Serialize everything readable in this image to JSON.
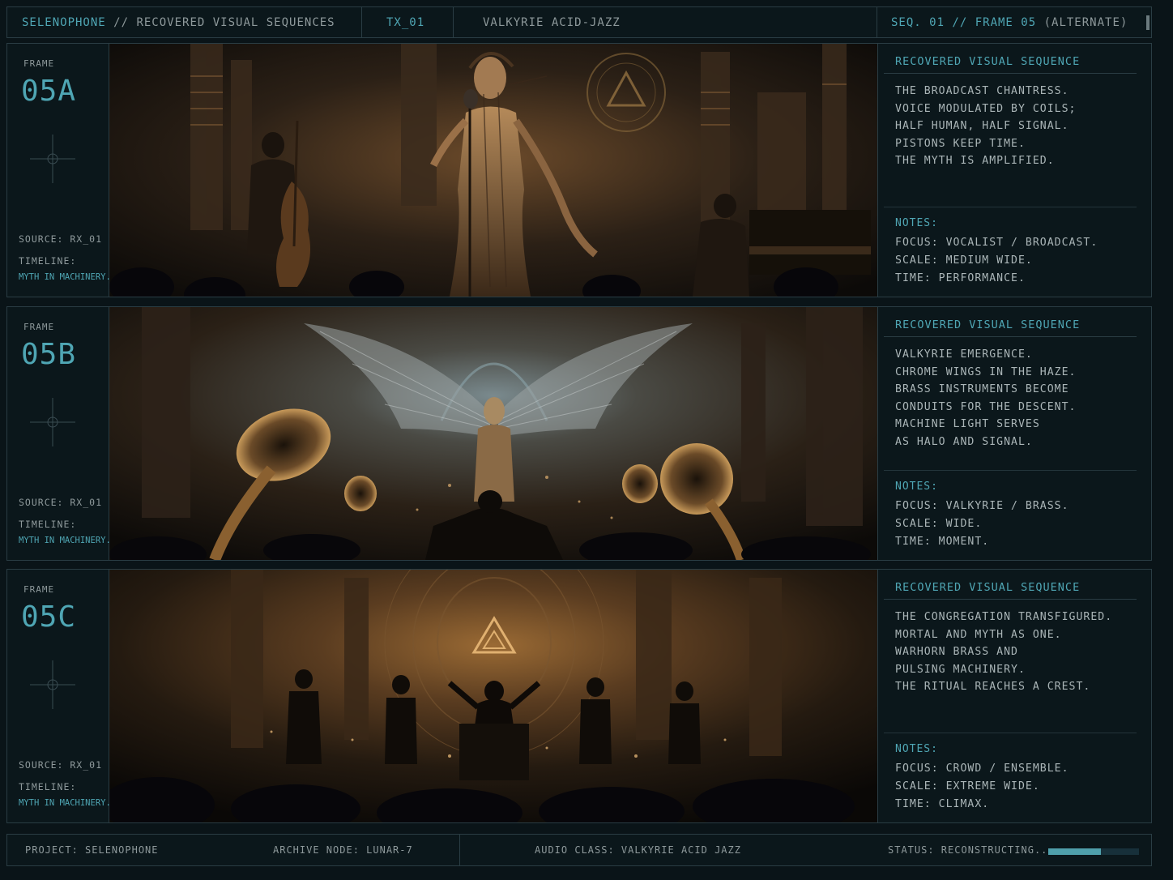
{
  "header": {
    "app": "SELENOPHONE",
    "divider": "//",
    "subtitle": "RECOVERED VISUAL SEQUENCES",
    "tx": "TX_01",
    "genre": "VALKYRIE ACID-JAZZ",
    "seq": "SEQ. 01 // FRAME 05",
    "seq_suffix": "(ALTERNATE)"
  },
  "frames": [
    {
      "label": "FRAME",
      "id": "05A",
      "source": "SOURCE: RX_01",
      "timeline_label": "TIMELINE:",
      "timeline_value": "MYTH IN MACHINERY.",
      "panel_title": "RECOVERED VISUAL SEQUENCE",
      "description": [
        "THE BROADCAST CHANTRESS.",
        "VOICE MODULATED BY COILS;",
        "HALF HUMAN, HALF SIGNAL.",
        "PISTONS KEEP TIME.",
        "THE MYTH IS AMPLIFIED."
      ],
      "notes_label": "NOTES:",
      "notes": [
        "FOCUS: VOCALIST / BROADCAST.",
        "SCALE: MEDIUM WIDE.",
        "TIME: PERFORMANCE."
      ]
    },
    {
      "label": "FRAME",
      "id": "05B",
      "source": "SOURCE: RX_01",
      "timeline_label": "TIMELINE:",
      "timeline_value": "MYTH IN MACHINERY.",
      "panel_title": "RECOVERED VISUAL SEQUENCE",
      "description": [
        "VALKYRIE EMERGENCE.",
        "CHROME WINGS IN THE HAZE.",
        "BRASS INSTRUMENTS BECOME",
        "CONDUITS FOR THE DESCENT.",
        "MACHINE LIGHT SERVES",
        "AS HALO AND SIGNAL."
      ],
      "notes_label": "NOTES:",
      "notes": [
        "FOCUS: VALKYRIE / BRASS.",
        "SCALE: WIDE.",
        "TIME: MOMENT."
      ]
    },
    {
      "label": "FRAME",
      "id": "05C",
      "source": "SOURCE: RX_01",
      "timeline_label": "TIMELINE:",
      "timeline_value": "MYTH IN MACHINERY.",
      "panel_title": "RECOVERED VISUAL SEQUENCE",
      "description": [
        "THE CONGREGATION TRANSFIGURED.",
        "MORTAL AND MYTH AS ONE.",
        "WARHORN BRASS AND",
        "PULSING MACHINERY.",
        "THE RITUAL REACHES A CREST."
      ],
      "notes_label": "NOTES:",
      "notes": [
        "FOCUS: CROWD / ENSEMBLE.",
        "SCALE: EXTREME WIDE.",
        "TIME: CLIMAX."
      ]
    }
  ],
  "footer": {
    "project": "PROJECT: SELENOPHONE",
    "archive": "ARCHIVE NODE: LUNAR-7",
    "audio": "AUDIO CLASS: VALKYRIE ACID JAZZ",
    "status": "STATUS: RECONSTRUCTING...",
    "progress": 0.58
  },
  "colors": {
    "accent": "#4fa6b4",
    "background": "#0a1418",
    "border": "#2a3d44",
    "text": "#a9b4b6"
  }
}
